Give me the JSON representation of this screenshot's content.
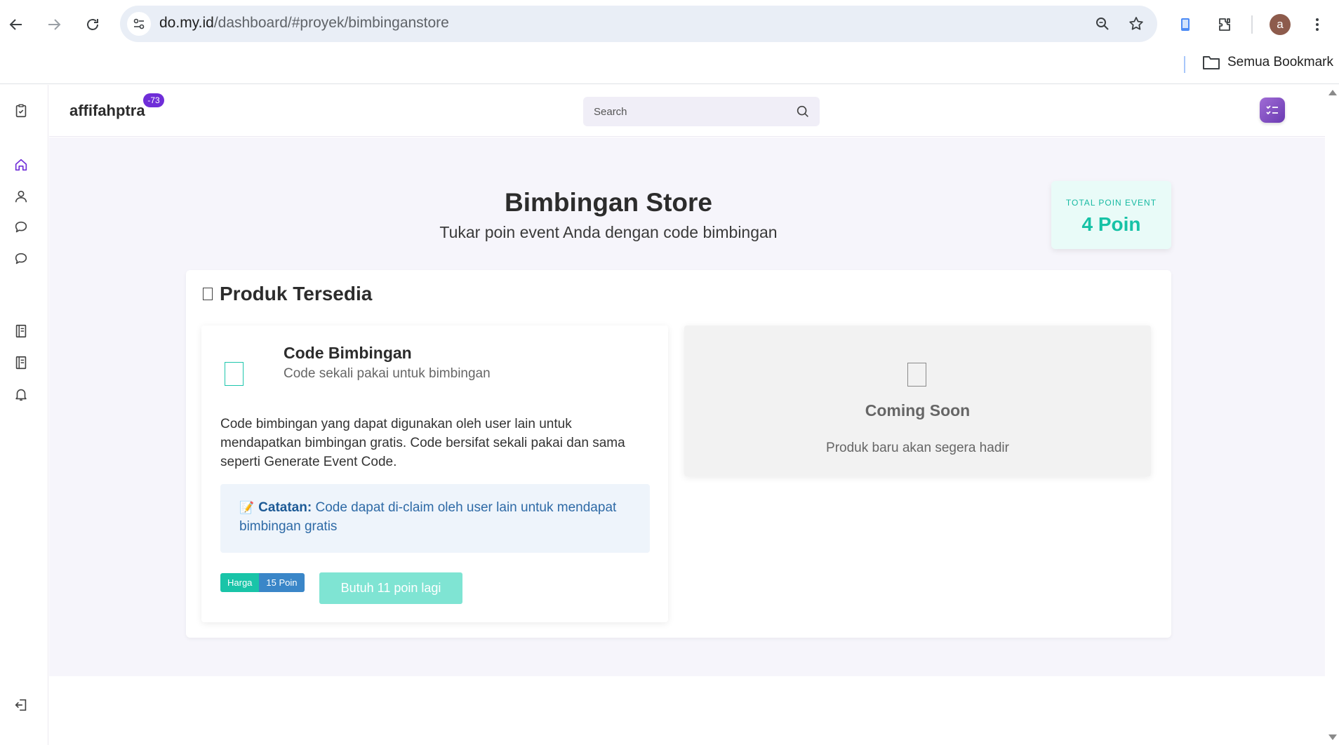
{
  "browser": {
    "url_host": "do.my.id",
    "url_path": "/dashboard/#proyek/bimbinganstore",
    "avatar_letter": "a",
    "bookmarks_all_label": "Semua Bookmark"
  },
  "topbar": {
    "username": "affifahptra",
    "notification_count": "-73",
    "search_placeholder": "Search"
  },
  "hero": {
    "title": "Bimbingan Store",
    "subtitle": "Tukar poin event Anda dengan code bimbingan"
  },
  "points": {
    "label": "TOTAL POIN EVENT",
    "value": "4 Poin"
  },
  "products": {
    "section_title": "Produk Tersedia",
    "items": [
      {
        "name": "Code Bimbingan",
        "tagline": "Code sekali pakai untuk bimbingan",
        "description": "Code bimbingan yang dapat digunakan oleh user lain untuk mendapatkan bimbingan gratis. Code bersifat sekali pakai dan sama seperti Generate Event Code.",
        "note_emoji": "📝",
        "note_label": "Catatan:",
        "note_text": "Code dapat di-claim oleh user lain untuk mendapat bimbingan gratis",
        "price_label": "Harga",
        "price_value": "15 Poin",
        "button_label": "Butuh 11 poin lagi"
      }
    ],
    "coming_soon": {
      "title": "Coming Soon",
      "text": "Produk baru akan segera hadir"
    }
  },
  "colors": {
    "accent_teal": "#16c2a6",
    "badge_purple": "#6f2ed8",
    "note_blue": "#2e6aa6",
    "page_bg": "#f6f5fb"
  },
  "icons": {
    "sidebar": [
      "clipboard-check-icon",
      "home-icon",
      "user-icon",
      "chat-icon",
      "chat-icon",
      "book-icon",
      "book-icon",
      "bell-icon",
      "logout-icon"
    ]
  }
}
